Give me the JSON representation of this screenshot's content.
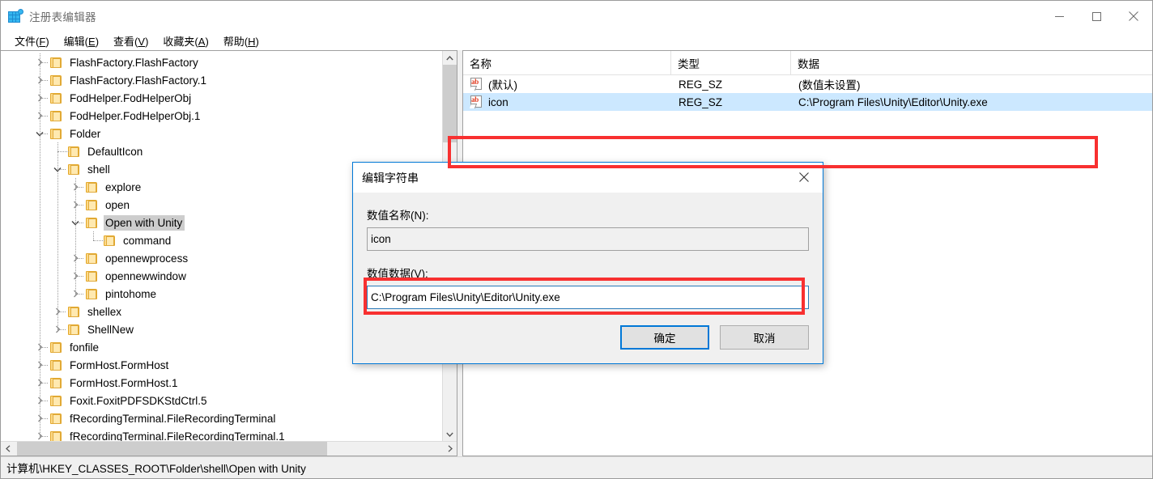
{
  "window": {
    "title": "注册表编辑器",
    "app_icon": "registry-grid-icon",
    "controls": {
      "minimize": "minimize-icon",
      "maximize": "maximize-icon",
      "close": "close-icon"
    }
  },
  "menubar": [
    {
      "label": "文件(F)",
      "text": "文件",
      "accel": "F"
    },
    {
      "label": "编辑(E)",
      "text": "编辑",
      "accel": "E"
    },
    {
      "label": "查看(V)",
      "text": "查看",
      "accel": "V"
    },
    {
      "label": "收藏夹(A)",
      "text": "收藏夹",
      "accel": "A"
    },
    {
      "label": "帮助(H)",
      "text": "帮助",
      "accel": "H"
    }
  ],
  "tree": {
    "items": [
      {
        "label": "FlashFactory.FlashFactory",
        "depth": 1,
        "expander": "collapsed",
        "selected": false
      },
      {
        "label": "FlashFactory.FlashFactory.1",
        "depth": 1,
        "expander": "collapsed",
        "selected": false
      },
      {
        "label": "FodHelper.FodHelperObj",
        "depth": 1,
        "expander": "collapsed",
        "selected": false
      },
      {
        "label": "FodHelper.FodHelperObj.1",
        "depth": 1,
        "expander": "collapsed",
        "selected": false
      },
      {
        "label": "Folder",
        "depth": 1,
        "expander": "expanded",
        "selected": false
      },
      {
        "label": "DefaultIcon",
        "depth": 2,
        "expander": "none",
        "selected": false
      },
      {
        "label": "shell",
        "depth": 2,
        "expander": "expanded",
        "selected": false
      },
      {
        "label": "explore",
        "depth": 3,
        "expander": "collapsed",
        "selected": false
      },
      {
        "label": "open",
        "depth": 3,
        "expander": "collapsed",
        "selected": false
      },
      {
        "label": "Open with Unity",
        "depth": 3,
        "expander": "expanded",
        "selected": true
      },
      {
        "label": "command",
        "depth": 4,
        "expander": "none",
        "selected": false
      },
      {
        "label": "opennewprocess",
        "depth": 3,
        "expander": "collapsed",
        "selected": false
      },
      {
        "label": "opennewwindow",
        "depth": 3,
        "expander": "collapsed",
        "selected": false
      },
      {
        "label": "pintohome",
        "depth": 3,
        "expander": "collapsed",
        "selected": false
      },
      {
        "label": "shellex",
        "depth": 2,
        "expander": "collapsed",
        "selected": false
      },
      {
        "label": "ShellNew",
        "depth": 2,
        "expander": "collapsed",
        "selected": false
      },
      {
        "label": "fonfile",
        "depth": 1,
        "expander": "collapsed",
        "selected": false
      },
      {
        "label": "FormHost.FormHost",
        "depth": 1,
        "expander": "collapsed",
        "selected": false
      },
      {
        "label": "FormHost.FormHost.1",
        "depth": 1,
        "expander": "collapsed",
        "selected": false
      },
      {
        "label": "Foxit.FoxitPDFSDKStdCtrl.5",
        "depth": 1,
        "expander": "collapsed",
        "selected": false
      },
      {
        "label": "fRecordingTerminal.FileRecordingTerminal",
        "depth": 1,
        "expander": "collapsed",
        "selected": false
      },
      {
        "label": "fRecordingTerminal.FileRecordingTerminal.1",
        "depth": 1,
        "expander": "collapsed",
        "selected": false
      }
    ],
    "scrollbar": {
      "up_arrow": "chevron-up-icon",
      "down_arrow": "chevron-down-icon",
      "left_arrow": "chevron-left-icon",
      "right_arrow": "chevron-right-icon"
    }
  },
  "list": {
    "columns": [
      "名称",
      "类型",
      "数据"
    ],
    "rows": [
      {
        "name": "(默认)",
        "type": "REG_SZ",
        "data": "(数值未设置)",
        "icon": "string-value-icon",
        "selected": false
      },
      {
        "name": "icon",
        "type": "REG_SZ",
        "data": "C:\\Program Files\\Unity\\Editor\\Unity.exe",
        "icon": "string-value-icon",
        "selected": true
      }
    ]
  },
  "dialog": {
    "title": "编辑字符串",
    "close_icon": "close-icon",
    "name_label": "数值名称(N):",
    "name_value": "icon",
    "data_label": "数值数据(V):",
    "data_value": "C:\\Program Files\\Unity\\Editor\\Unity.exe",
    "ok_label": "确定",
    "cancel_label": "取消"
  },
  "statusbar": {
    "path": "计算机\\HKEY_CLASSES_ROOT\\Folder\\shell\\Open with Unity"
  },
  "annotations": {
    "color": "#f83030",
    "boxes": [
      "registry-value-row-highlight",
      "dialog-value-data-highlight"
    ]
  }
}
